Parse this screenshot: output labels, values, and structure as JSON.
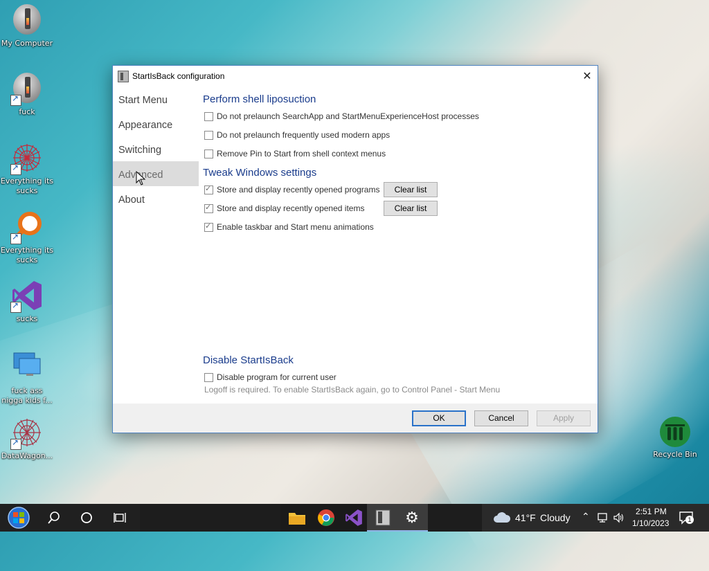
{
  "desktop": {
    "icons": [
      {
        "label": "My Computer",
        "icon": "computer-icon"
      },
      {
        "label": "fuck",
        "icon": "computer-icon"
      },
      {
        "label": "Everything its sucks",
        "icon": "snowflake-icon"
      },
      {
        "label": "Everything its sucks",
        "icon": "magnifier-icon"
      },
      {
        "label": "sucks",
        "icon": "visual-studio-icon"
      },
      {
        "label": "fuck ass nigga kids f...",
        "icon": "monitors-icon"
      },
      {
        "label": "DataWagon...",
        "icon": "snowflake-icon"
      },
      {
        "label": "Recycle Bin",
        "icon": "recycle-bin-icon"
      }
    ]
  },
  "window": {
    "title": "StartIsBack configuration",
    "close_glyph": "✕",
    "sidebar": [
      "Start Menu",
      "Appearance",
      "Switching",
      "Advanced",
      "About"
    ],
    "selected_sidebar": "Advanced",
    "sections": {
      "shell": {
        "title": "Perform shell liposuction",
        "options": [
          {
            "label": "Do not prelaunch SearchApp and StartMenuExperienceHost processes",
            "checked": false
          },
          {
            "label": "Do not prelaunch frequently used modern apps",
            "checked": false
          },
          {
            "label": "Remove Pin to Start from shell context menus",
            "checked": false
          }
        ]
      },
      "tweak": {
        "title": "Tweak Windows settings",
        "options": [
          {
            "label": "Store and display recently opened programs",
            "checked": true,
            "button": "Clear list"
          },
          {
            "label": "Store and display recently opened items",
            "checked": true,
            "button": "Clear list"
          },
          {
            "label": "Enable taskbar and Start menu animations",
            "checked": true
          }
        ]
      },
      "disable": {
        "title": "Disable StartIsBack",
        "options": [
          {
            "label": "Disable program for current user",
            "checked": false
          }
        ],
        "note": "Logoff is required. To enable StartIsBack again, go to Control Panel - Start Menu"
      }
    },
    "footer": {
      "ok": "OK",
      "cancel": "Cancel",
      "apply": "Apply"
    }
  },
  "taskbar": {
    "left_icons": [
      "windows-start-icon",
      "search-icon",
      "cortana-icon",
      "task-view-icon"
    ],
    "pinned": [
      "file-explorer-icon",
      "chrome-icon",
      "visual-studio-icon",
      "startisback-icon",
      "settings-icon"
    ],
    "weather": {
      "temp": "41°F",
      "condition": "Cloudy"
    },
    "clock": {
      "time": "2:51 PM",
      "date": "1/10/2023"
    },
    "notification_count": "1"
  }
}
